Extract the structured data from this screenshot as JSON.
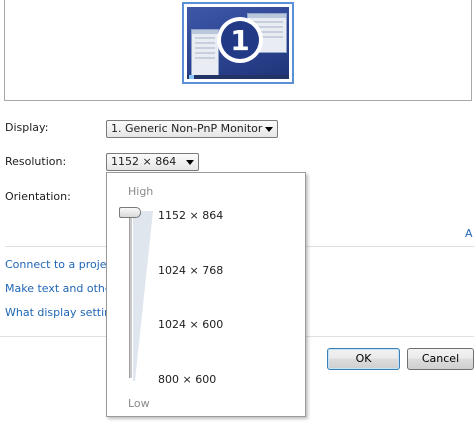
{
  "preview": {
    "monitor_number": "1"
  },
  "form": {
    "display_label": "Display:",
    "display_value": "1. Generic Non-PnP Monitor",
    "resolution_label": "Resolution:",
    "resolution_value": "1152 × 864",
    "orientation_label": "Orientation:"
  },
  "advanced_settings_link": "A",
  "links": {
    "connect_projector": "Connect to a projec",
    "make_text_larger": "Make text and other",
    "what_display_settings": "What display setting"
  },
  "buttons": {
    "ok": "OK",
    "cancel": "Cancel"
  },
  "resolution_slider": {
    "high_label": "High",
    "low_label": "Low",
    "options": [
      "1152 × 864",
      "1024 × 768",
      "1024 × 600",
      "800 × 600"
    ],
    "selected_index": 0
  },
  "colors": {
    "link": "#1f66b5",
    "accent_border": "#5b8fd6",
    "desktop_blue": "#2c4390"
  }
}
